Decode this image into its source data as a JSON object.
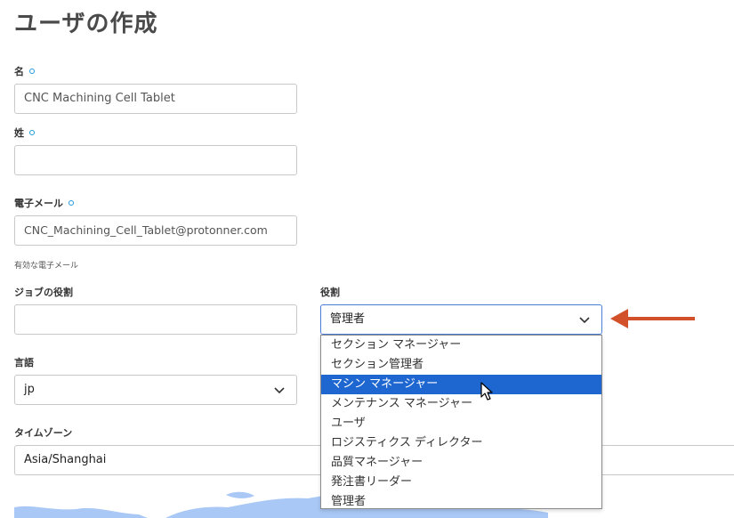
{
  "page": {
    "title": "ユーザの作成"
  },
  "form": {
    "first_name": {
      "label": "名",
      "value": "CNC Machining Cell Tablet"
    },
    "last_name": {
      "label": "姓",
      "value": ""
    },
    "email": {
      "label": "電子メール",
      "value": "CNC_Machining_Cell_Tablet@protonner.com",
      "hint": "有効な電子メール"
    },
    "job_role": {
      "label": "ジョブの役割",
      "value": ""
    },
    "role": {
      "label": "役割",
      "value": "管理者",
      "options": [
        "セクション マネージャー",
        "セクション管理者",
        "マシン マネージャー",
        "メンテナンス マネージャー",
        "ユーザ",
        "ロジスティクス ディレクター",
        "品質マネージャー",
        "発注書リーダー",
        "管理者"
      ],
      "highlighted_index": 2
    },
    "language": {
      "label": "言語",
      "value": "jp"
    },
    "timezone": {
      "label": "タイムゾーン",
      "value": "Asia/Shanghai"
    }
  },
  "icons": {
    "required": "required-dot-icon",
    "chevron": "chevron-down-icon",
    "annotation": "red-arrow-icon",
    "cursor": "mouse-pointer-icon"
  },
  "colors": {
    "required_dot": "#1f9bd7",
    "highlight": "#1e66d0",
    "annotation_arrow": "#d2502a",
    "map": "#a9c8f5"
  }
}
